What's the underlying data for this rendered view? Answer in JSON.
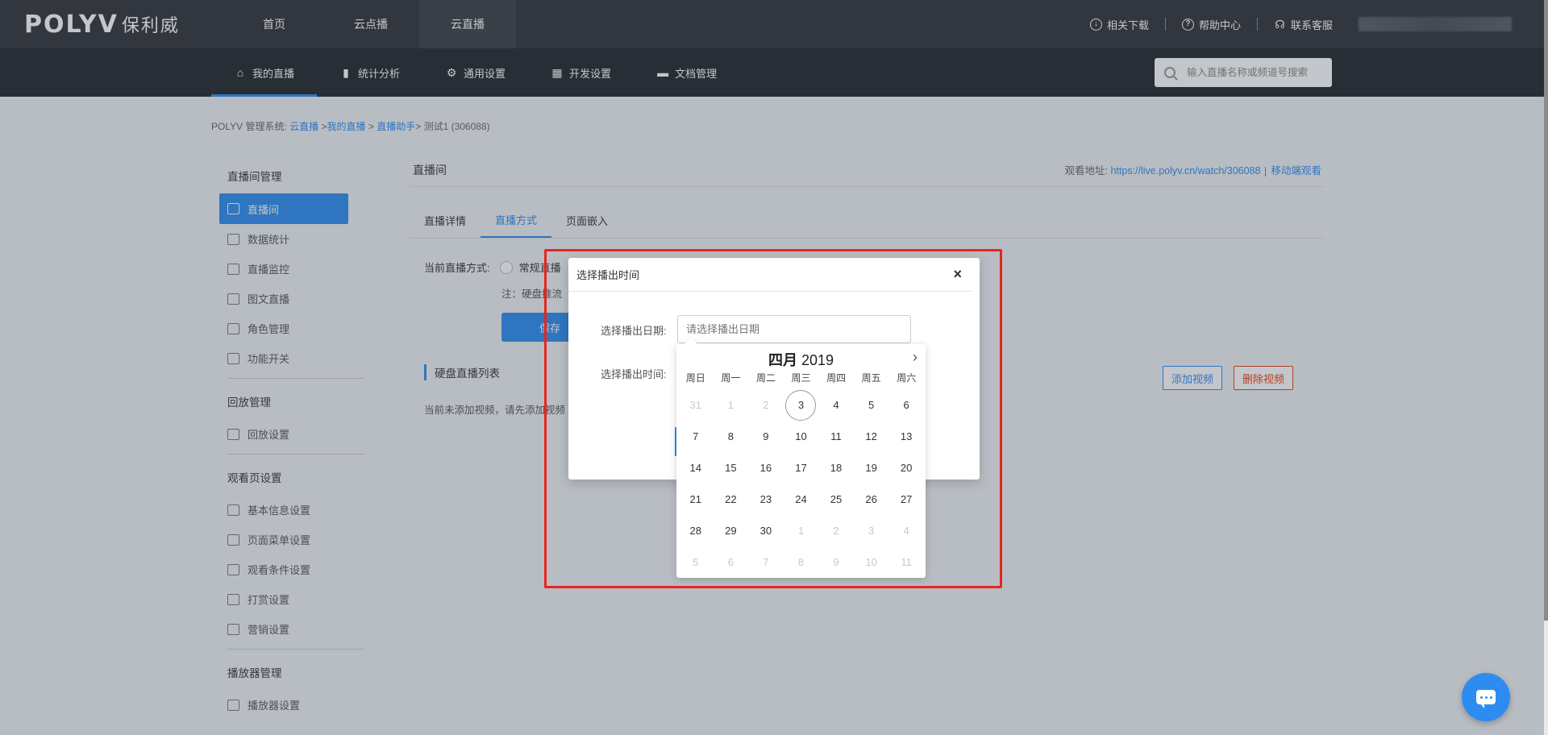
{
  "topbar": {
    "logo_mark": "POLYV",
    "logo_cn": "保利威",
    "nav": [
      {
        "label": "首页"
      },
      {
        "label": "云点播"
      },
      {
        "label": "云直播"
      }
    ],
    "right": [
      {
        "label": "相关下载",
        "icon": "download-icon"
      },
      {
        "label": "帮助中心",
        "icon": "help-icon"
      },
      {
        "label": "联系客服",
        "icon": "headset-icon"
      }
    ]
  },
  "subbar": {
    "nav": [
      {
        "label": "我的直播",
        "icon": "home-icon"
      },
      {
        "label": "统计分析",
        "icon": "bar-chart-icon"
      },
      {
        "label": "通用设置",
        "icon": "gear-icon"
      },
      {
        "label": "开发设置",
        "icon": "grid-icon"
      },
      {
        "label": "文档管理",
        "icon": "folder-icon"
      }
    ],
    "search_placeholder": "输入直播名称或频道号搜索"
  },
  "breadcrumb": {
    "prefix": "POLYV 管理系统:",
    "c1": "云直播",
    "c2": "我的直播",
    "c3": "直播助手",
    "current": "测试1 (306088)",
    "sep1": " >",
    "sep2": " > ",
    "sep3": "> "
  },
  "sidebar": {
    "groups": [
      {
        "title": "直播间管理",
        "items": [
          "直播间",
          "数据统计",
          "直播监控",
          "图文直播",
          "角色管理",
          "功能开关"
        ]
      },
      {
        "title": "回放管理",
        "items": [
          "回放设置"
        ]
      },
      {
        "title": "观看页设置",
        "items": [
          "基本信息设置",
          "页面菜单设置",
          "观看条件设置",
          "打赏设置",
          "营销设置"
        ]
      },
      {
        "title": "播放器管理",
        "items": [
          "播放器设置"
        ]
      }
    ]
  },
  "content": {
    "title": "直播间",
    "watch_label": "观看地址:",
    "watch_url": "https://live.polyv.cn/watch/306088",
    "mobile_watch": "移动端观看",
    "tabs": [
      "直播详情",
      "直播方式",
      "页面嵌入"
    ],
    "mode_label": "当前直播方式:",
    "mode_option": "常规直播",
    "note": "注：硬盘推流",
    "save": "保存",
    "section_title": "硬盘直播列表",
    "empty_tip": "当前未添加视频，请先添加视频",
    "add_video": "添加视频",
    "delete_video": "删除视频"
  },
  "modal": {
    "title": "选择播出时间",
    "close": "×",
    "date_label": "选择播出日期:",
    "date_placeholder": "请选择播出日期",
    "time_label": "选择播出时间:"
  },
  "picker": {
    "month": "四月",
    "year": "2019",
    "next": "›",
    "weekdays": [
      "周日",
      "周一",
      "周二",
      "周三",
      "周四",
      "周五",
      "周六"
    ],
    "days": [
      {
        "d": "31",
        "muted": true
      },
      {
        "d": "1",
        "muted": true
      },
      {
        "d": "2",
        "muted": true
      },
      {
        "d": "3",
        "today": true
      },
      {
        "d": "4"
      },
      {
        "d": "5"
      },
      {
        "d": "6"
      },
      {
        "d": "7"
      },
      {
        "d": "8"
      },
      {
        "d": "9"
      },
      {
        "d": "10"
      },
      {
        "d": "11"
      },
      {
        "d": "12"
      },
      {
        "d": "13"
      },
      {
        "d": "14"
      },
      {
        "d": "15"
      },
      {
        "d": "16"
      },
      {
        "d": "17"
      },
      {
        "d": "18"
      },
      {
        "d": "19"
      },
      {
        "d": "20"
      },
      {
        "d": "21"
      },
      {
        "d": "22"
      },
      {
        "d": "23"
      },
      {
        "d": "24"
      },
      {
        "d": "25"
      },
      {
        "d": "26"
      },
      {
        "d": "27"
      },
      {
        "d": "28"
      },
      {
        "d": "29"
      },
      {
        "d": "30"
      },
      {
        "d": "1",
        "muted": true
      },
      {
        "d": "2",
        "muted": true
      },
      {
        "d": "3",
        "muted": true
      },
      {
        "d": "4",
        "muted": true
      },
      {
        "d": "5",
        "muted": true
      },
      {
        "d": "6",
        "muted": true
      },
      {
        "d": "7",
        "muted": true
      },
      {
        "d": "8",
        "muted": true
      },
      {
        "d": "9",
        "muted": true
      },
      {
        "d": "10",
        "muted": true
      },
      {
        "d": "11",
        "muted": true
      }
    ]
  },
  "colors": {
    "accent": "#2d8cf0",
    "danger": "#ed3f14",
    "highlight": "#e8251e",
    "topbar": "#2e3238"
  }
}
